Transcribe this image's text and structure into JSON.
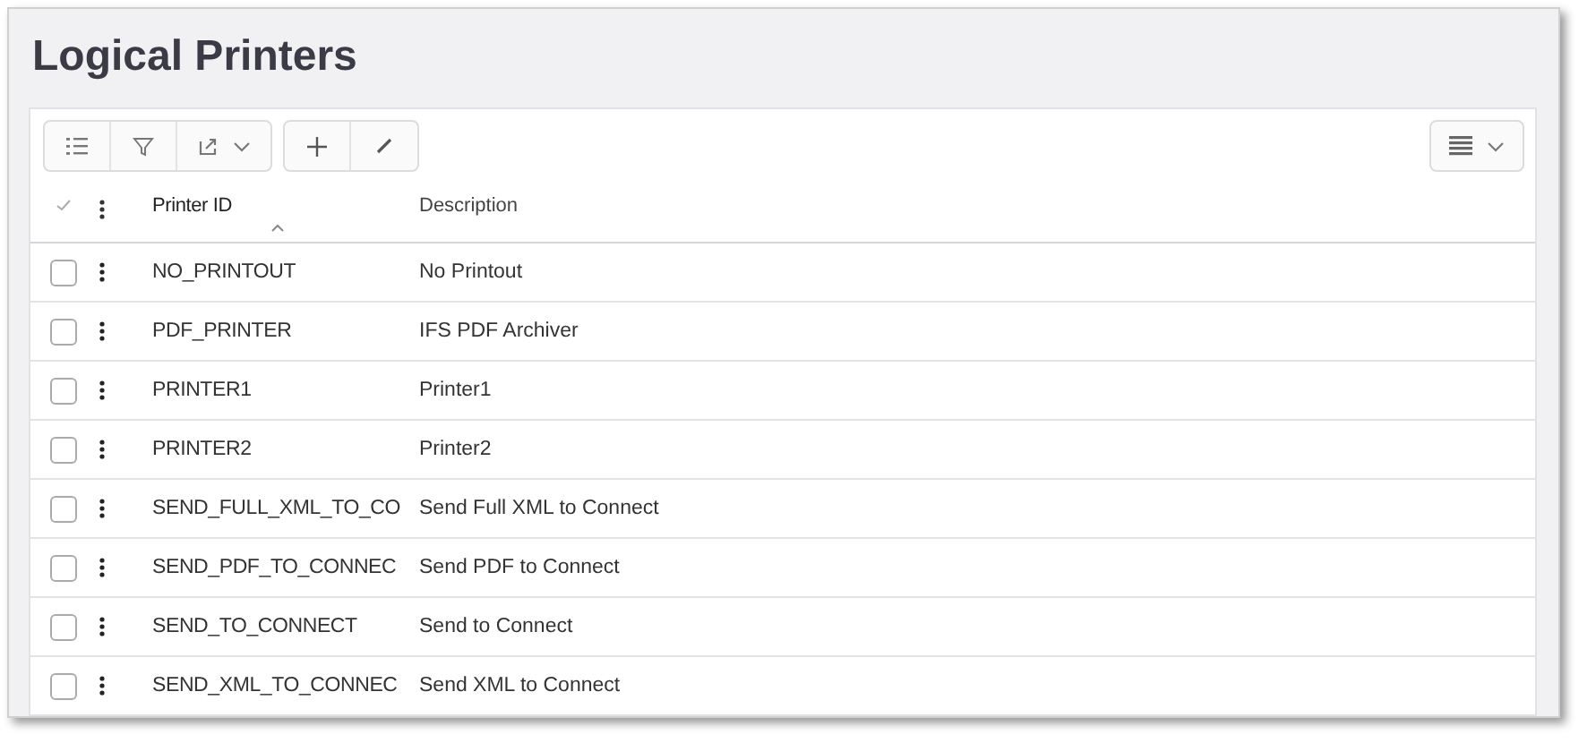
{
  "page": {
    "title": "Logical Printers"
  },
  "table": {
    "columns": [
      {
        "label": "Printer ID",
        "sorted": true
      },
      {
        "label": "Description",
        "sorted": false
      }
    ],
    "rows": [
      {
        "printer_id": "NO_PRINTOUT",
        "description": "No Printout",
        "selected": false
      },
      {
        "printer_id": "PDF_PRINTER",
        "description": "IFS PDF Archiver",
        "selected": false
      },
      {
        "printer_id": "PRINTER1",
        "description": "Printer1",
        "selected": false
      },
      {
        "printer_id": "PRINTER2",
        "description": "Printer2",
        "selected": false
      },
      {
        "printer_id": "SEND_FULL_XML_TO_CO",
        "description": "Send Full XML to Connect",
        "selected": false
      },
      {
        "printer_id": "SEND_PDF_TO_CONNEC",
        "description": "Send PDF to Connect",
        "selected": false
      },
      {
        "printer_id": "SEND_TO_CONNECT",
        "description": "Send to Connect",
        "selected": false
      },
      {
        "printer_id": "SEND_XML_TO_CONNEC",
        "description": "Send XML to Connect",
        "selected": false
      }
    ]
  }
}
